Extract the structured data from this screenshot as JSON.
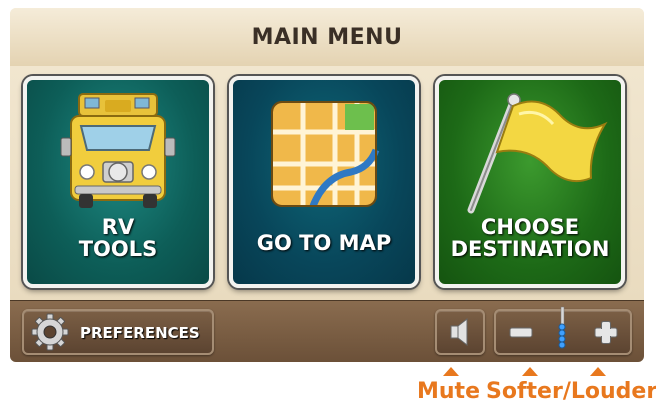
{
  "header": {
    "title": "MAIN MENU"
  },
  "tiles": [
    {
      "label": "RV\nTOOLS",
      "icon": "rv-truck-icon"
    },
    {
      "label": "GO TO MAP",
      "icon": "map-icon"
    },
    {
      "label": "CHOOSE\nDESTINATION",
      "icon": "flag-icon"
    }
  ],
  "bottom_bar": {
    "preferences_label": "PREFERENCES",
    "preferences_icon": "gear-icon",
    "mute_icon": "speaker-icon",
    "volume_down_icon": "minus-icon",
    "volume_up_icon": "plus-icon",
    "volume_level_icon": "volume-level-icon"
  },
  "annotations": {
    "mute": "Mute",
    "softer_louder": "Softer/Louder"
  },
  "colors": {
    "accent": "#e8781e",
    "rv_tile": "#0d5e58",
    "map_tile": "#08465a",
    "destination_tile": "#1d6a17",
    "bar": "#6b5038"
  }
}
